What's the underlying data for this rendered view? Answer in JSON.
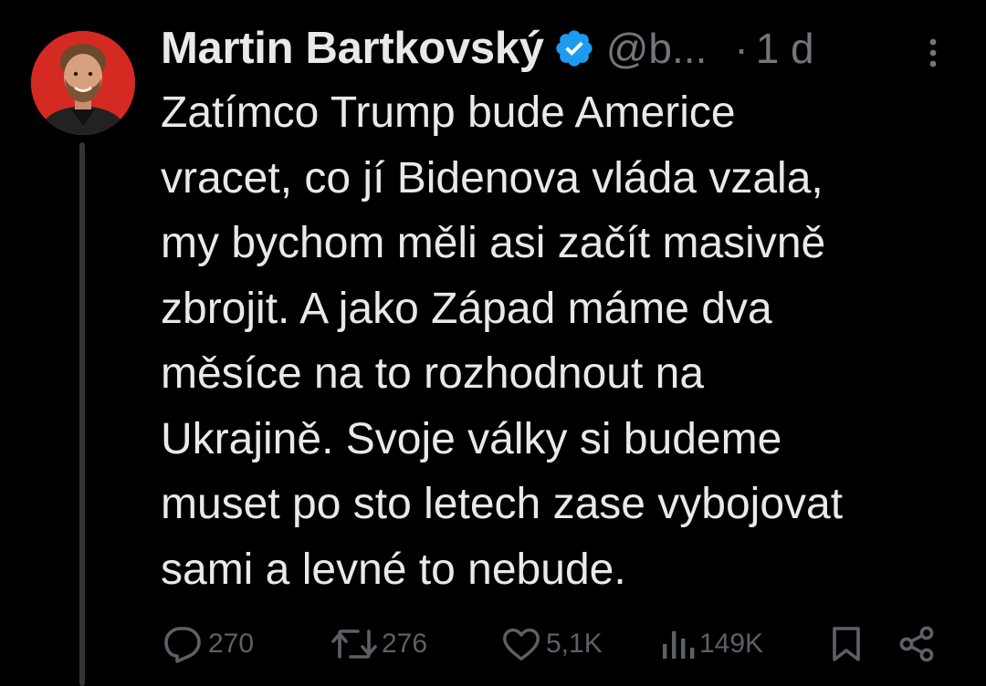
{
  "author": {
    "display_name": "Martin Bartkovský",
    "handle": "@b...",
    "verified": true,
    "avatar_icon": "avatar-photo"
  },
  "meta": {
    "separator": "·",
    "time": "1 d",
    "more_icon": "more-vertical-icon"
  },
  "text_lines": [
    "Zatímco Trump bude Americe",
    "vracet, co jí Bidenova vláda vzala,",
    "my bychom měli asi začít masivně",
    "zbrojit. A jako Západ máme dva",
    "měsíce na to rozhodnout na",
    "Ukrajině. Svoje války si budeme",
    "muset po sto letech zase vybojovat",
    "sami a levné to nebude."
  ],
  "actions": {
    "reply": {
      "icon": "reply-icon",
      "count": "270"
    },
    "repost": {
      "icon": "repost-icon",
      "count": "276"
    },
    "like": {
      "icon": "heart-icon",
      "count": "5,1K"
    },
    "views": {
      "icon": "views-icon",
      "count": "149K"
    },
    "bookmark": {
      "icon": "bookmark-icon"
    },
    "share": {
      "icon": "share-icon"
    }
  },
  "colors": {
    "background": "#000000",
    "text": "#e7e9ea",
    "secondary": "#71767b",
    "action": "#5b6166",
    "verified": "#1d9bf0",
    "thread_line": "#333639",
    "avatar_bg": "#d42a22"
  }
}
